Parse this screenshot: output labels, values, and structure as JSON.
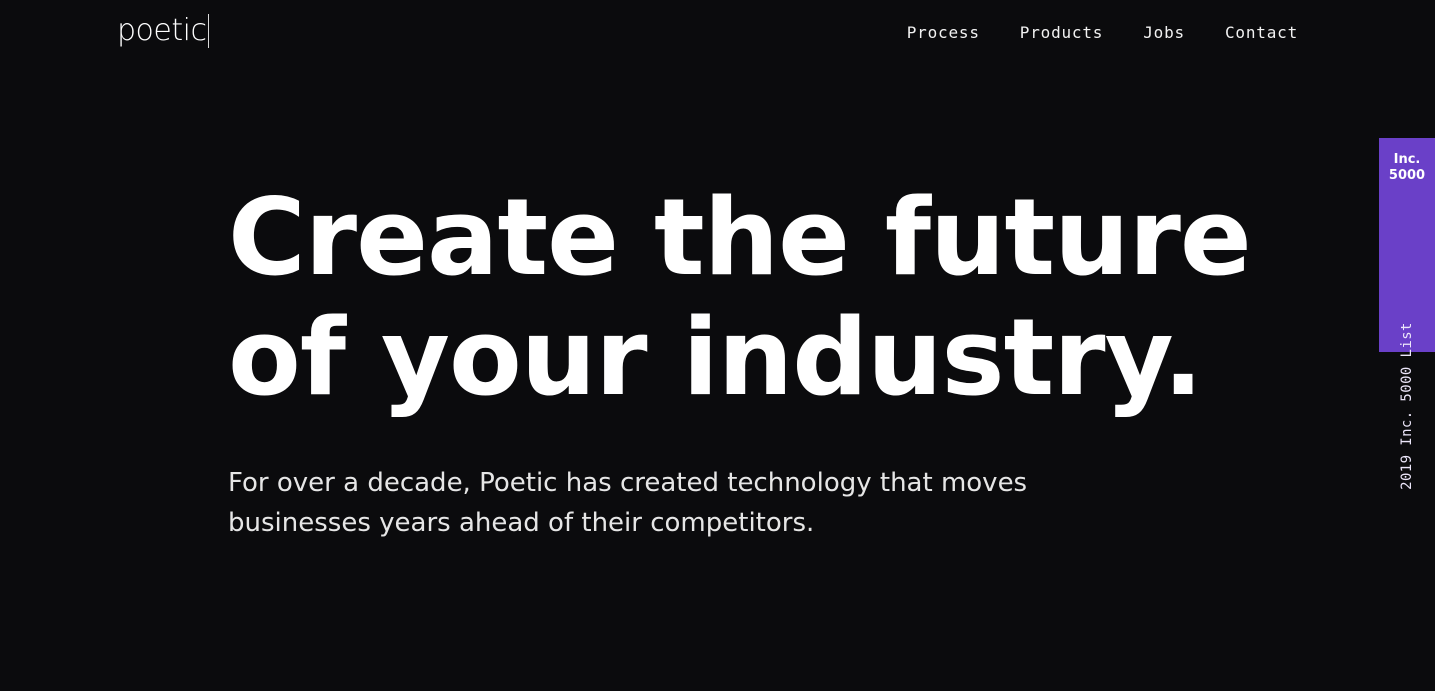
{
  "header": {
    "logo_text": "poetic",
    "nav": [
      {
        "label": "Process"
      },
      {
        "label": "Products"
      },
      {
        "label": "Jobs"
      },
      {
        "label": "Contact"
      }
    ]
  },
  "hero": {
    "headline_line1": "Create the future",
    "headline_line2": "of your industry.",
    "subtitle": "For over a decade, Poetic has created technology that moves businesses years ahead of their competitors."
  },
  "badge": {
    "title_line1": "Inc.",
    "title_line2": "5000",
    "vertical_text": "2019 Inc. 5000 List",
    "color": "#6a40c8"
  },
  "colors": {
    "background": "#0b0b0d",
    "text": "#ffffff"
  }
}
